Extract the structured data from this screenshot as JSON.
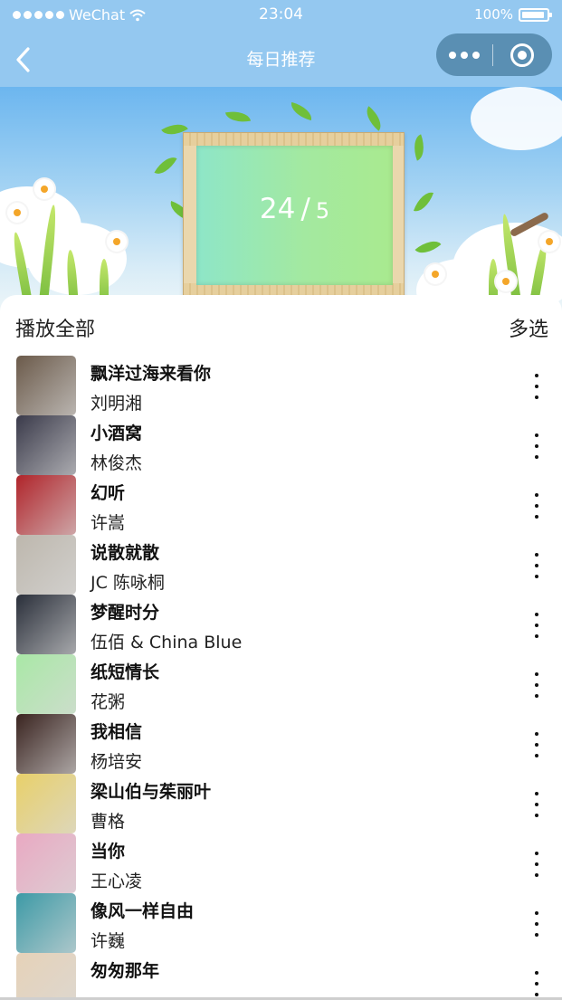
{
  "status_bar": {
    "carrier": "WeChat",
    "time": "23:04",
    "battery": "100%"
  },
  "nav": {
    "title": "每日推荐"
  },
  "banner": {
    "current": "24",
    "separator": "/",
    "total": "5"
  },
  "toolbar": {
    "play_all": "播放全部",
    "multi_select": "多选"
  },
  "songs": [
    {
      "title": "飘洋过海来看你",
      "artist": "刘明湘",
      "cover_color": "#6b5a4a"
    },
    {
      "title": "小酒窝",
      "artist": "林俊杰",
      "cover_color": "#3a3a4a"
    },
    {
      "title": "幻听",
      "artist": "许嵩",
      "cover_color": "#b0242a"
    },
    {
      "title": "说散就散",
      "artist": "JC 陈咏桐",
      "cover_color": "#bdb7ad"
    },
    {
      "title": "梦醒时分",
      "artist": "伍佰 & China Blue",
      "cover_color": "#2a2f3a"
    },
    {
      "title": "纸短情长",
      "artist": "花粥",
      "cover_color": "#a9e8a6"
    },
    {
      "title": "我相信",
      "artist": "杨培安",
      "cover_color": "#3a2420"
    },
    {
      "title": "梁山伯与茱丽叶",
      "artist": "曹格",
      "cover_color": "#e8d06a"
    },
    {
      "title": "当你",
      "artist": "王心凌",
      "cover_color": "#e9a9c2"
    },
    {
      "title": "像风一样自由",
      "artist": "许巍",
      "cover_color": "#3d9aa6"
    },
    {
      "title": "匆匆那年",
      "artist": "",
      "cover_color": "#e6d2b8"
    }
  ]
}
